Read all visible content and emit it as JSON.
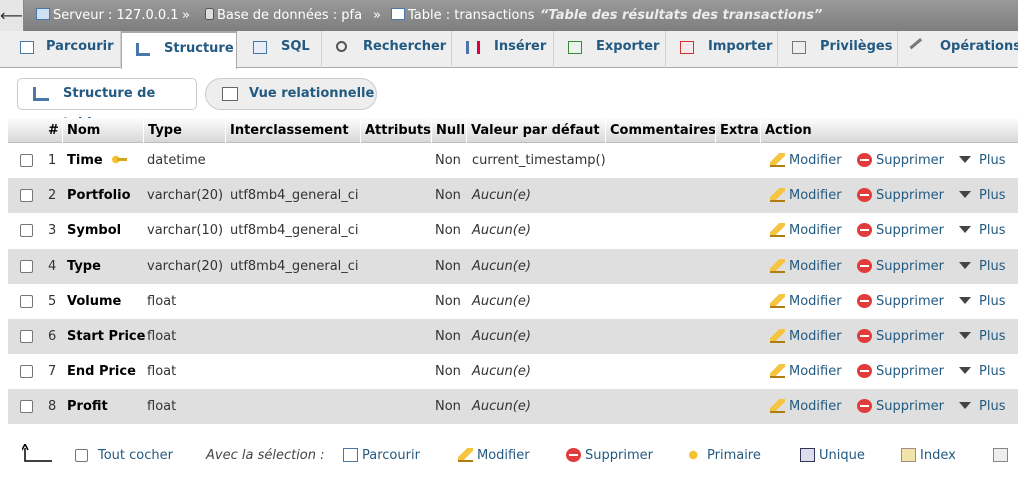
{
  "breadcrumb": {
    "back_symbol": "⟵",
    "server": "Serveur : 127.0.0.1",
    "separator": "»",
    "database": "Base de données : pfa",
    "table": "Table : transactions",
    "comment": "“Table des résultats des transactions”"
  },
  "tabs": [
    {
      "label": "Parcourir",
      "icon": "browse-icon"
    },
    {
      "label": "Structure",
      "icon": "structure-icon",
      "active": true
    },
    {
      "label": "SQL",
      "icon": "sql-icon"
    },
    {
      "label": "Rechercher",
      "icon": "search-icon"
    },
    {
      "label": "Insérer",
      "icon": "insert-icon"
    },
    {
      "label": "Exporter",
      "icon": "export-icon"
    },
    {
      "label": "Importer",
      "icon": "import-icon"
    },
    {
      "label": "Privilèges",
      "icon": "privileges-icon"
    },
    {
      "label": "Opérations",
      "icon": "operations-icon"
    }
  ],
  "subnav": {
    "table_structure": "Structure de table",
    "relational_view": "Vue relationnelle"
  },
  "columns": {
    "num": "#",
    "name": "Nom",
    "type": "Type",
    "collation": "Interclassement",
    "attributes": "Attributs",
    "null": "Null",
    "default": "Valeur par défaut",
    "comments": "Commentaires",
    "extra": "Extra",
    "action": "Action"
  },
  "actions": {
    "modify": "Modifier",
    "delete": "Supprimer",
    "more": "Plus"
  },
  "rows": [
    {
      "num": "1",
      "name": "Time",
      "type": "datetime",
      "collation": "",
      "null": "Non",
      "default": "current_timestamp()",
      "primary": true
    },
    {
      "num": "2",
      "name": "Portfolio",
      "type": "varchar(20)",
      "collation": "utf8mb4_general_ci",
      "null": "Non",
      "default": "Aucun(e)"
    },
    {
      "num": "3",
      "name": "Symbol",
      "type": "varchar(10)",
      "collation": "utf8mb4_general_ci",
      "null": "Non",
      "default": "Aucun(e)"
    },
    {
      "num": "4",
      "name": "Type",
      "type": "varchar(20)",
      "collation": "utf8mb4_general_ci",
      "null": "Non",
      "default": "Aucun(e)"
    },
    {
      "num": "5",
      "name": "Volume",
      "type": "float",
      "collation": "",
      "null": "Non",
      "default": "Aucun(e)"
    },
    {
      "num": "6",
      "name": "Start Price",
      "type": "float",
      "collation": "",
      "null": "Non",
      "default": "Aucun(e)"
    },
    {
      "num": "7",
      "name": "End Price",
      "type": "float",
      "collation": "",
      "null": "Non",
      "default": "Aucun(e)"
    },
    {
      "num": "8",
      "name": "Profit",
      "type": "float",
      "collation": "",
      "null": "Non",
      "default": "Aucun(e)"
    }
  ],
  "footer": {
    "check_all": "Tout cocher",
    "with_selection": "Avec la sélection :",
    "browse": "Parcourir",
    "modify": "Modifier",
    "delete": "Supprimer",
    "primary": "Primaire",
    "unique": "Unique",
    "index": "Index"
  }
}
